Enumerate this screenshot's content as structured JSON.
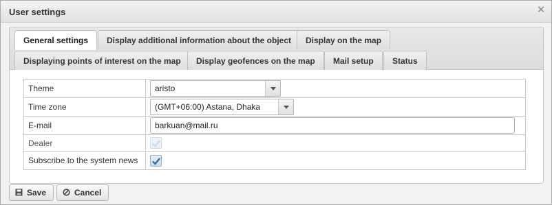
{
  "window": {
    "title": "User settings"
  },
  "tabs": [
    {
      "label": "General settings",
      "active": true
    },
    {
      "label": "Display additional information about the object"
    },
    {
      "label": "Display on the map"
    },
    {
      "label": "Displaying points of interest on the map"
    },
    {
      "label": "Display geofences on the map"
    },
    {
      "label": "Mail setup"
    },
    {
      "label": "Status"
    }
  ],
  "form": {
    "theme": {
      "label": "Theme",
      "value": "aristo"
    },
    "timezone": {
      "label": "Time zone",
      "value": "(GMT+06:00) Astana, Dhaka"
    },
    "email": {
      "label": "E-mail",
      "value": "barkuan@mail.ru"
    },
    "dealer": {
      "label": "Dealer",
      "checked": true,
      "disabled": true
    },
    "news": {
      "label": "Subscribe to the system news",
      "checked": true
    }
  },
  "buttons": {
    "save": "Save",
    "cancel": "Cancel"
  },
  "icons": {
    "close": "close-icon",
    "save": "floppy-disk-icon",
    "cancel": "cancel-circle-icon",
    "check": "checkmark-icon",
    "dropdown": "chevron-down-icon"
  },
  "colors": {
    "check": "#2f6f9a",
    "check_disabled": "#8fb0c8"
  }
}
